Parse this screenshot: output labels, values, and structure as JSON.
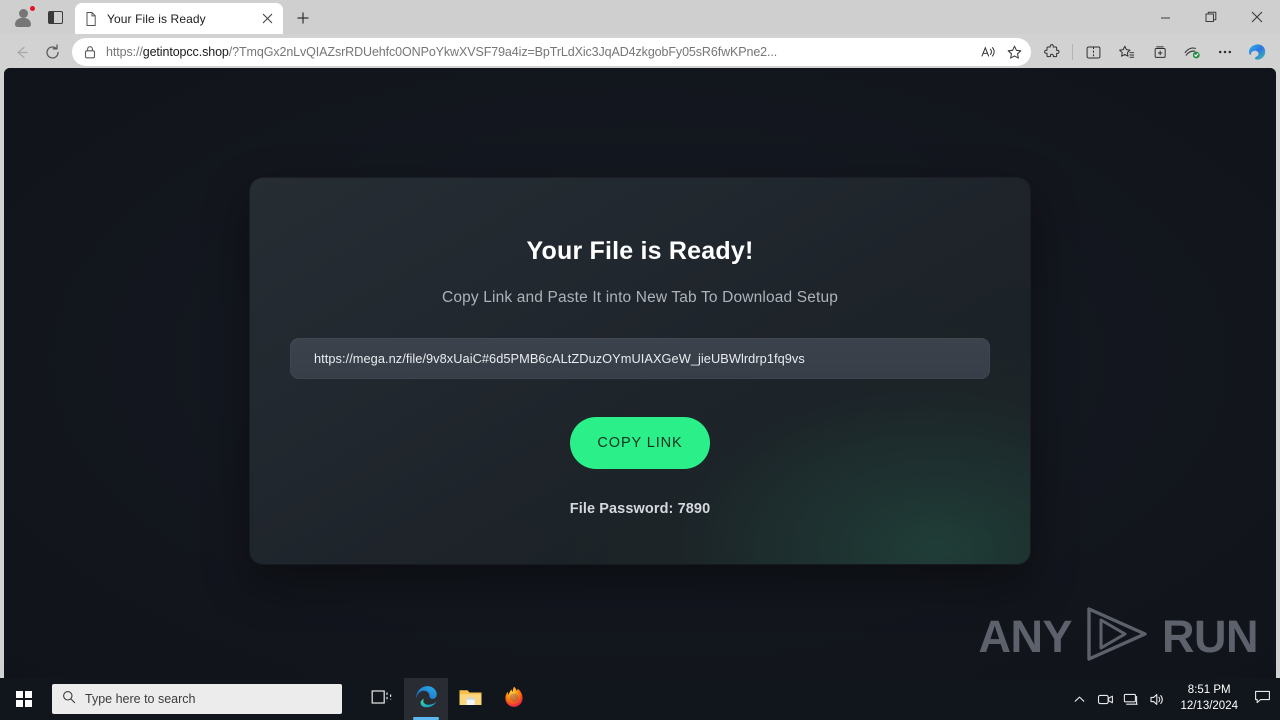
{
  "browser": {
    "tab": {
      "title": "Your File is Ready",
      "favicon_icon": "page-icon",
      "close_icon": "close-icon"
    },
    "new_tab_label": "+",
    "profile_icon": "account-avatar-icon",
    "tab_actions_icon": "tab-sidebar-icon",
    "window_controls": {
      "minimize": "minimize-icon",
      "restore": "restore-icon",
      "close": "close-icon"
    },
    "address": {
      "url_secure_prefix": "https://",
      "url_domain": "getintopcc.shop",
      "url_path": "/?TmqGx2nLvQIAZsrRDUehfc0ONPoYkwXVSF79a4iz=BpTrLdXic3JqAD4zkgobFy05sR6fwKPne2...",
      "lock_icon": "lock-icon",
      "read_aloud_icon": "read-aloud-icon",
      "favorite_icon": "star-icon"
    },
    "nav": {
      "back_icon": "arrow-left-icon",
      "refresh_icon": "refresh-icon"
    },
    "toolbar_icons": [
      "extensions-puzzle-icon",
      "split-screen-icon",
      "favorites-star-list-icon",
      "collections-add-icon",
      "browser-essentials-icon",
      "settings-more-icon",
      "copilot-icon"
    ]
  },
  "page": {
    "title": "Your File is Ready!",
    "subtitle": "Copy Link and Paste It into New Tab To Download Setup",
    "download_link": "https://mega.nz/file/9v8xUaiC#6d5PMB6cALtZDuzOYmUIAXGeW_jieUBWlrdrp1fq9vs",
    "copy_button_label": "COPY LINK",
    "copy_button_color": "#2bf08a",
    "file_password": "File Password: 7890",
    "background_color": "#12151c",
    "card_color": "#222930"
  },
  "watermark": {
    "left_text": "ANY",
    "right_text": "RUN",
    "play_icon": "play-triangle-icon"
  },
  "taskbar": {
    "start_icon": "windows-start-icon",
    "search_placeholder": "Type here to search",
    "search_icon": "search-icon",
    "task_view_icon": "task-view-icon",
    "apps": [
      {
        "name": "edge-icon",
        "active": true
      },
      {
        "name": "file-explorer-icon",
        "active": false
      },
      {
        "name": "firefox-icon",
        "active": false
      }
    ],
    "tray": {
      "overflow_icon": "chevron-up-icon",
      "meet_now_icon": "meet-now-icon",
      "network_icon": "network-icon",
      "volume_icon": "volume-icon",
      "action_center_icon": "action-center-icon",
      "time": "8:51 PM",
      "date": "12/13/2024"
    }
  }
}
